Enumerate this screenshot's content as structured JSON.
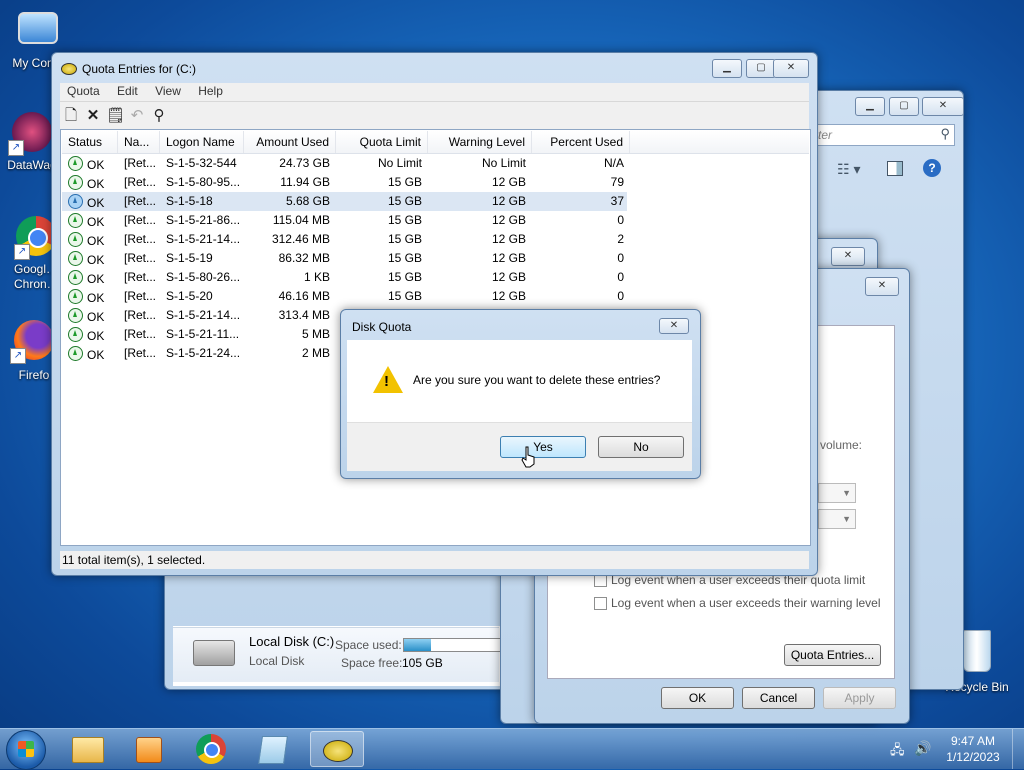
{
  "desktop": {
    "icons": [
      {
        "label": "My Comp"
      },
      {
        "label": "DataWag"
      },
      {
        "label": "Googl… Chron…"
      },
      {
        "label": "Firefo"
      },
      {
        "label": "Recycle Bin"
      }
    ]
  },
  "explorer_window": {
    "search_placeholder": "ter",
    "drive_name": "Local Disk (C:)",
    "drive_type": "Local Disk",
    "space_used_label": "Space used:",
    "space_free_label": "Space free:",
    "space_free_value": "105 GB",
    "space_used_fraction": 0.28
  },
  "properties_window": {
    "volume_text": "volume:",
    "log_limit": "Log event when a user exceeds their quota limit",
    "log_warning": "Log event when a user exceeds their warning level",
    "quota_entries_button": "Quota Entries...",
    "ok": "OK",
    "cancel": "Cancel",
    "apply": "Apply"
  },
  "quota_window": {
    "title": "Quota Entries for  (C:)",
    "menu": [
      "Quota",
      "Edit",
      "View",
      "Help"
    ],
    "columns": [
      "Status",
      "Na...",
      "Logon Name",
      "Amount Used",
      "Quota Limit",
      "Warning Level",
      "Percent Used"
    ],
    "rows": [
      {
        "status": "OK",
        "name": "[Ret...",
        "logon": "S-1-5-32-544",
        "used": "24.73 GB",
        "limit": "No Limit",
        "warning": "No Limit",
        "percent": "N/A",
        "selected": false
      },
      {
        "status": "OK",
        "name": "[Ret...",
        "logon": "S-1-5-80-95...",
        "used": "11.94 GB",
        "limit": "15 GB",
        "warning": "12 GB",
        "percent": "79",
        "selected": false
      },
      {
        "status": "OK",
        "name": "[Ret...",
        "logon": "S-1-5-18",
        "used": "5.68 GB",
        "limit": "15 GB",
        "warning": "12 GB",
        "percent": "37",
        "selected": true
      },
      {
        "status": "OK",
        "name": "[Ret...",
        "logon": "S-1-5-21-86...",
        "used": "115.04 MB",
        "limit": "15 GB",
        "warning": "12 GB",
        "percent": "0",
        "selected": false
      },
      {
        "status": "OK",
        "name": "[Ret...",
        "logon": "S-1-5-21-14...",
        "used": "312.46 MB",
        "limit": "15 GB",
        "warning": "12 GB",
        "percent": "2",
        "selected": false
      },
      {
        "status": "OK",
        "name": "[Ret...",
        "logon": "S-1-5-19",
        "used": "86.32 MB",
        "limit": "15 GB",
        "warning": "12 GB",
        "percent": "0",
        "selected": false
      },
      {
        "status": "OK",
        "name": "[Ret...",
        "logon": "S-1-5-80-26...",
        "used": "1 KB",
        "limit": "15 GB",
        "warning": "12 GB",
        "percent": "0",
        "selected": false
      },
      {
        "status": "OK",
        "name": "[Ret...",
        "logon": "S-1-5-20",
        "used": "46.16 MB",
        "limit": "15 GB",
        "warning": "12 GB",
        "percent": "0",
        "selected": false
      },
      {
        "status": "OK",
        "name": "[Ret...",
        "logon": "S-1-5-21-14...",
        "used": "313.4 MB",
        "limit": "",
        "warning": "",
        "percent": "",
        "selected": false
      },
      {
        "status": "OK",
        "name": "[Ret...",
        "logon": "S-1-5-21-11...",
        "used": "5 MB",
        "limit": "",
        "warning": "",
        "percent": "",
        "selected": false
      },
      {
        "status": "OK",
        "name": "[Ret...",
        "logon": "S-1-5-21-24...",
        "used": "2 MB",
        "limit": "",
        "warning": "",
        "percent": "",
        "selected": false
      }
    ],
    "status_text": "11 total item(s), 1 selected."
  },
  "dialog": {
    "title": "Disk Quota",
    "message": "Are you sure you want to delete these entries?",
    "yes": "Yes",
    "no": "No"
  },
  "taskbar": {
    "time": "9:47 AM",
    "date": "1/12/2023"
  }
}
